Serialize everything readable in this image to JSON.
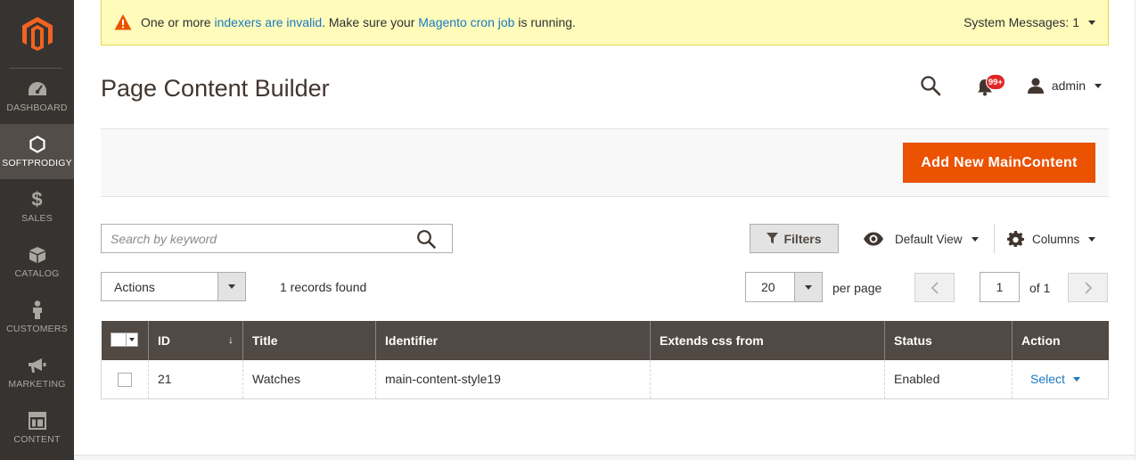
{
  "sidebar": {
    "logo": "magento-logo",
    "items": [
      {
        "label": "DASHBOARD",
        "icon": "dashboard-icon"
      },
      {
        "label": "SOFTPRODIGY",
        "icon": "hexagon-icon",
        "active": true
      },
      {
        "label": "SALES",
        "icon": "dollar-icon"
      },
      {
        "label": "CATALOG",
        "icon": "box-icon"
      },
      {
        "label": "CUSTOMERS",
        "icon": "person-icon"
      },
      {
        "label": "MARKETING",
        "icon": "megaphone-icon"
      },
      {
        "label": "CONTENT",
        "icon": "layout-icon"
      }
    ]
  },
  "system_message": {
    "text_before": "One or more ",
    "link1": "indexers are invalid",
    "text_middle": ". Make sure your ",
    "link2": "Magento cron job",
    "text_after": " is running.",
    "count_label": "System Messages: 1"
  },
  "header": {
    "title": "Page Content Builder",
    "notification_badge": "99+",
    "user": "admin"
  },
  "page_actions": {
    "add_button": "Add New MainContent"
  },
  "toolbar": {
    "search_placeholder": "Search by keyword",
    "filters": "Filters",
    "default_view": "Default View",
    "columns": "Columns",
    "actions": "Actions",
    "records_found": "1 records found",
    "per_page_value": "20",
    "per_page_label": "per page",
    "current_page": "1",
    "page_of": "of 1"
  },
  "grid": {
    "columns": [
      "ID",
      "Title",
      "Identifier",
      "Extends css from",
      "Status",
      "Action"
    ],
    "rows": [
      {
        "id": "21",
        "title": "Watches",
        "identifier": "main-content-style19",
        "extends": "",
        "status": "Enabled",
        "action": "Select"
      }
    ]
  },
  "colors": {
    "sidebar_bg": "#373330",
    "accent": "#eb5202",
    "grid_header": "#514943",
    "link": "#1979c3",
    "message_bg": "#fffbbb"
  }
}
